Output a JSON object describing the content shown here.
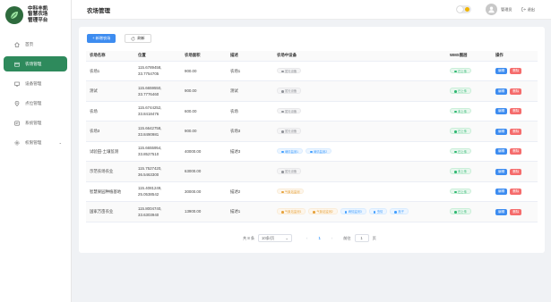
{
  "app": {
    "brand_line1": "中科丰凯",
    "brand_line2": "智慧农场",
    "brand_line3": "管理平台"
  },
  "sidebar": {
    "items": [
      {
        "label": "首页",
        "icon": "home-icon",
        "active": false
      },
      {
        "label": "农场管理",
        "icon": "farm-icon",
        "active": true
      },
      {
        "label": "设备管理",
        "icon": "device-icon",
        "active": false
      },
      {
        "label": "点位管理",
        "icon": "location-icon",
        "active": false
      },
      {
        "label": "系统管理",
        "icon": "system-icon",
        "active": false
      },
      {
        "label": "权限管理",
        "icon": "permission-icon",
        "active": false
      }
    ]
  },
  "header": {
    "title": "农场管理",
    "user_name": "管理员",
    "logout_label": "退出"
  },
  "toolbar": {
    "add_label": "+ 新增农场",
    "refresh_label": "刷新"
  },
  "table": {
    "headers": [
      "农场名称",
      "位置",
      "农场面积",
      "描述",
      "农场中设备",
      "WMS图层",
      "操作"
    ],
    "rows": [
      {
        "name": "农场1",
        "lng": "115.6789458,",
        "lat": "33.7754705",
        "area": "900.00",
        "desc": "农场1",
        "devices": [
          {
            "label": "暂无设备",
            "color": "gray"
          }
        ],
        "wms": "已上传",
        "wms_color": "green"
      },
      {
        "name": "测试",
        "lng": "115.6659550,",
        "lat": "33.7776460",
        "area": "900.00",
        "desc": "测试",
        "devices": [
          {
            "label": "暂无设备",
            "color": "gray"
          }
        ],
        "wms": "已上传",
        "wms_color": "green"
      },
      {
        "name": "农场",
        "lng": "115.6744252,",
        "lat": "33.8418476",
        "area": "600.00",
        "desc": "农场",
        "devices": [
          {
            "label": "暂无设备",
            "color": "gray"
          }
        ],
        "wms": "未上传",
        "wms_color": "green"
      },
      {
        "name": "农场3",
        "lng": "115.6642758,",
        "lat": "33.8490981",
        "area": "900.00",
        "desc": "农场3",
        "devices": [
          {
            "label": "暂无设备",
            "color": "gray"
          }
        ],
        "wms": "已上传",
        "wms_color": "green"
      },
      {
        "name": "试验田-土壤监测",
        "lng": "115.6655954,",
        "lat": "33.8527510",
        "area": "40000.00",
        "desc": "描述3",
        "devices": [
          {
            "label": "墒情监测1",
            "color": "blue"
          },
          {
            "label": "墒情监测2",
            "color": "blue"
          }
        ],
        "wms": "已上传",
        "wms_color": "green"
      },
      {
        "name": "示范农场农业",
        "lng": "115.7527420,",
        "lat": "36.5463300",
        "area": "63000.00",
        "desc": "",
        "devices": [
          {
            "label": "暂无设备",
            "color": "gray"
          }
        ],
        "wms": "未上传",
        "wms_color": "green"
      },
      {
        "name": "智慧果园种植基地",
        "lng": "115.4081249,",
        "lat": "25.0538542",
        "area": "30000.00",
        "desc": "描述2",
        "devices": [
          {
            "label": "气象站监测",
            "color": "orange"
          }
        ],
        "wms": "已上传",
        "wms_color": "green"
      },
      {
        "name": "国家万亩农业",
        "lng": "115.8004740,",
        "lat": "33.6303940",
        "area": "13900.00",
        "desc": "描述1",
        "devices": [
          {
            "label": "气象站监测1",
            "color": "orange"
          },
          {
            "label": "气象站监测2",
            "color": "orange"
          },
          {
            "label": "墒情监测3",
            "color": "blue"
          },
          {
            "label": "虫情",
            "color": "blue"
          },
          {
            "label": "孢子",
            "color": "blue"
          }
        ],
        "wms": "已上传",
        "wms_color": "green"
      }
    ],
    "edit_label": "编辑",
    "delete_label": "删除"
  },
  "pagination": {
    "total_label": "共 8 条",
    "page_size": "10条/页",
    "current_page": "1",
    "goto_label": "前往",
    "goto_value": "1",
    "page_unit": "页"
  }
}
